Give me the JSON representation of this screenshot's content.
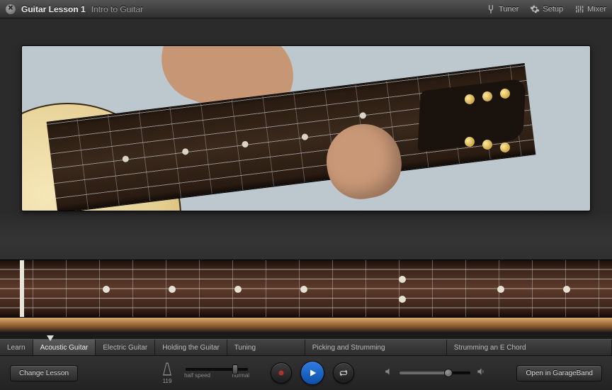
{
  "header": {
    "title": "Guitar Lesson 1",
    "subtitle": "Intro to Guitar",
    "tools": {
      "tuner": "Tuner",
      "setup": "Setup",
      "mixer": "Mixer"
    }
  },
  "chapters": [
    {
      "label": "Learn",
      "active": false
    },
    {
      "label": "Acoustic Guitar",
      "active": true
    },
    {
      "label": "Electric Guitar",
      "active": false
    },
    {
      "label": "Holding the Guitar",
      "active": false
    },
    {
      "label": "Tuning",
      "active": false
    },
    {
      "label": "Picking and Strumming",
      "active": false
    },
    {
      "label": "Strumming an E Chord",
      "active": false
    }
  ],
  "controls": {
    "change_lesson": "Change Lesson",
    "tempo_bpm": "119",
    "speed": {
      "value_pct": 82,
      "label_min": "half speed",
      "label_max": "normal"
    },
    "volume_pct": 72,
    "open_in": "Open in GarageBand"
  }
}
